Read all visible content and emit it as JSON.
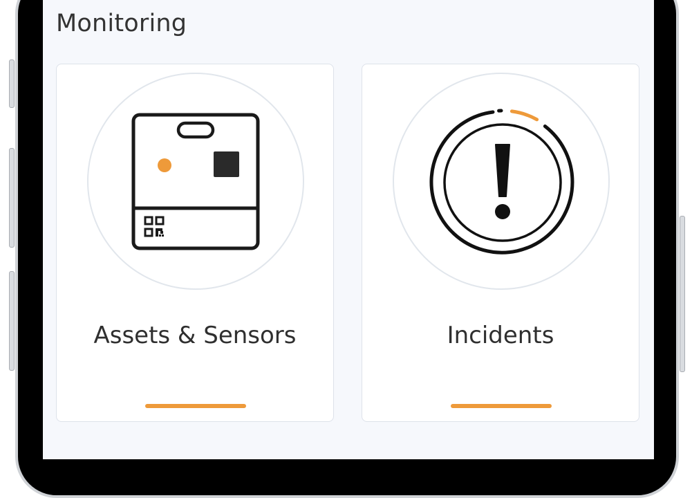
{
  "section": {
    "title": "Monitoring"
  },
  "tiles": [
    {
      "label": "Assets & Sensors",
      "icon": "asset-sensor-device-icon"
    },
    {
      "label": "Incidents",
      "icon": "incident-alert-icon"
    }
  ],
  "colors": {
    "accent": "#EE9A3A",
    "screen_bg": "#F6F8FC",
    "card_bg": "#FFFFFF",
    "icon_stroke": "#1A1A1A",
    "circle_border": "#E1E6EC"
  }
}
